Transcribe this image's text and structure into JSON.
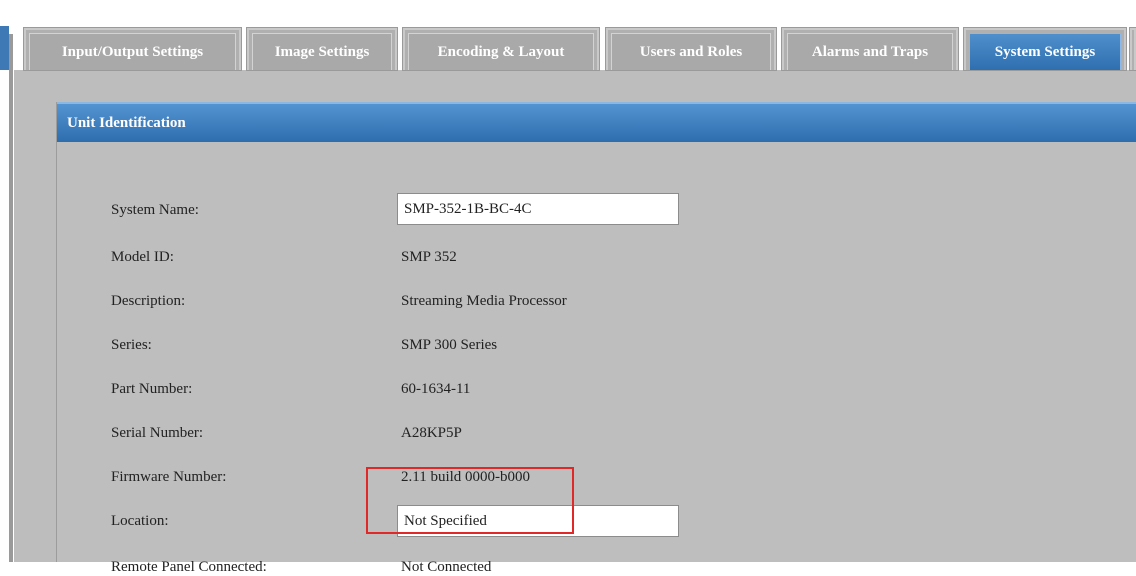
{
  "tabs": [
    {
      "label": "Input/Output Settings",
      "active": false
    },
    {
      "label": "Image Settings",
      "active": false
    },
    {
      "label": "Encoding & Layout",
      "active": false
    },
    {
      "label": "Users and Roles",
      "active": false
    },
    {
      "label": "Alarms and Traps",
      "active": false
    },
    {
      "label": "System Settings",
      "active": true
    }
  ],
  "panel": {
    "title": "Unit Identification",
    "system_name": {
      "label": "System Name:",
      "value": "SMP-352-1B-BC-4C"
    },
    "model_id": {
      "label": "Model ID:",
      "value": "SMP 352"
    },
    "description": {
      "label": "Description:",
      "value": "Streaming Media Processor"
    },
    "series": {
      "label": "Series:",
      "value": "SMP 300 Series"
    },
    "part_number": {
      "label": "Part Number:",
      "value": "60-1634-11"
    },
    "serial_number": {
      "label": "Serial Number:",
      "value": "A28KP5P"
    },
    "firmware_number": {
      "label": "Firmware Number:",
      "value": "2.11 build 0000-b000"
    },
    "location": {
      "label": "Location:",
      "value": "Not Specified"
    },
    "remote_panel": {
      "label": "Remote Panel Connected:",
      "value": "Not Connected"
    }
  },
  "colors": {
    "accent": "#2f6fb0",
    "highlight": "#e02828"
  }
}
